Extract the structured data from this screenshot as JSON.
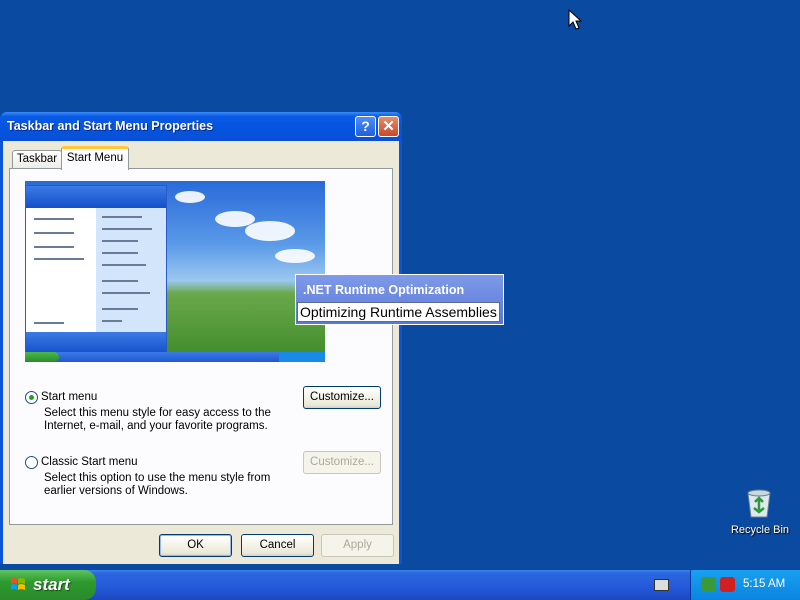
{
  "window": {
    "title": "Taskbar and Start Menu Properties",
    "help_label": "?",
    "close_label": "✕"
  },
  "tabs": [
    {
      "label": "Taskbar",
      "active": false
    },
    {
      "label": "Start Menu",
      "active": true
    }
  ],
  "options": [
    {
      "label": "Start menu",
      "selected": true,
      "description": "Select this menu style for easy access to the Internet, e-mail, and your favorite programs.",
      "customize_label": "Customize...",
      "customize_enabled": true
    },
    {
      "label": "Classic Start menu",
      "selected": false,
      "description": "Select this option to use the menu style from earlier versions of Windows.",
      "customize_label": "Customize...",
      "customize_enabled": false
    }
  ],
  "dialog_buttons": {
    "ok": "OK",
    "cancel": "Cancel",
    "apply": "Apply"
  },
  "popup": {
    "title": ".NET Runtime Optimization",
    "message": "Optimizing Runtime Assemblies"
  },
  "taskbar": {
    "start_label": "start",
    "clock": "5:15 AM"
  },
  "desktop": {
    "recycle_bin_label": "Recycle Bin"
  },
  "colors": {
    "desktop": "#0a4aa0",
    "titlebar": "#0454e0",
    "start_green": "#2e9a2e",
    "tray": "#0a84e0"
  }
}
